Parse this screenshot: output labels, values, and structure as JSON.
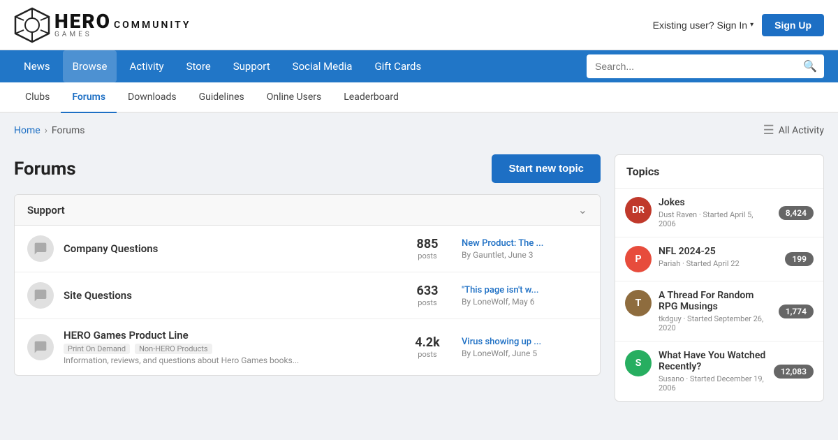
{
  "header": {
    "logo_hero": "HERO",
    "logo_community": "COMMUNITY",
    "logo_games": "GAMES",
    "sign_in_label": "Existing user? Sign In",
    "sign_in_arrow": "▾",
    "sign_up_label": "Sign Up"
  },
  "navbar": {
    "items": [
      {
        "label": "News",
        "active": false
      },
      {
        "label": "Browse",
        "active": true
      },
      {
        "label": "Activity",
        "active": false
      },
      {
        "label": "Store",
        "active": false
      },
      {
        "label": "Support",
        "active": false
      },
      {
        "label": "Social Media",
        "active": false
      },
      {
        "label": "Gift Cards",
        "active": false
      }
    ],
    "search_placeholder": "Search..."
  },
  "subnav": {
    "items": [
      {
        "label": "Clubs",
        "active": false
      },
      {
        "label": "Forums",
        "active": true
      },
      {
        "label": "Downloads",
        "active": false
      },
      {
        "label": "Guidelines",
        "active": false
      },
      {
        "label": "Online Users",
        "active": false
      },
      {
        "label": "Leaderboard",
        "active": false
      }
    ]
  },
  "breadcrumb": {
    "home": "Home",
    "current": "Forums"
  },
  "all_activity": "All Activity",
  "forums_title": "Forums",
  "start_topic": "Start new topic",
  "support_section": {
    "title": "Support",
    "rows": [
      {
        "name": "Company Questions",
        "posts_count": "885",
        "posts_label": "posts",
        "latest_title": "New Product: The ...",
        "latest_meta": "By Gauntlet, June 3",
        "sub_items": [],
        "desc": ""
      },
      {
        "name": "Site Questions",
        "posts_count": "633",
        "posts_label": "posts",
        "latest_title": "\"This page isn't w...",
        "latest_meta": "By LoneWolf, May 6",
        "sub_items": [],
        "desc": ""
      },
      {
        "name": "HERO Games Product Line",
        "posts_count": "4.2k",
        "posts_label": "posts",
        "latest_title": "Virus showing up ...",
        "latest_meta": "By LoneWolf, June 5",
        "sub_items": [
          "Print On Demand",
          "Non-HERO Products"
        ],
        "desc": "Information, reviews, and questions about Hero Games books..."
      }
    ]
  },
  "topics": {
    "header": "Topics",
    "items": [
      {
        "title": "Jokes",
        "meta": "Dust Raven · Started April 5, 2006",
        "count": "8,424",
        "avatar_color": "#c0392b",
        "avatar_initials": "DR"
      },
      {
        "title": "NFL 2024-25",
        "meta": "Pariah · Started April 22",
        "count": "199",
        "avatar_color": "#e74c3c",
        "avatar_initials": "P"
      },
      {
        "title": "A Thread For Random RPG Musings",
        "meta": "tkdguy · Started September 26, 2020",
        "count": "1,774",
        "avatar_color": "#8e6c3e",
        "avatar_initials": "T"
      },
      {
        "title": "What Have You Watched Recently?",
        "meta": "Susano · Started December 19, 2006",
        "count": "12,083",
        "avatar_color": "#27ae60",
        "avatar_initials": "S"
      }
    ]
  }
}
